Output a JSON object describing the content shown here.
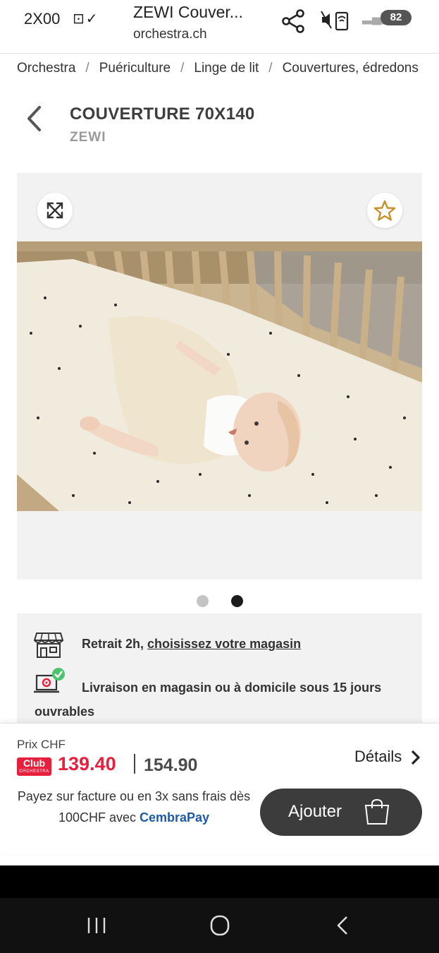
{
  "status_bar": {
    "time": "2X00",
    "left_icons": "⊡✓",
    "battery": "82",
    "signal_icon": "signal-bars-icon"
  },
  "browser": {
    "page_title": "ZEWI Couver...",
    "url": "orchestra.ch"
  },
  "breadcrumb": [
    "Orchestra",
    "Puériculture",
    "Linge de lit",
    "Couvertures, édredons"
  ],
  "breadcrumb_separator": "/",
  "product": {
    "title": "COUVERTURE 70X140",
    "brand": "ZEWI"
  },
  "gallery": {
    "total_images": 2,
    "active_index": 2
  },
  "info": {
    "pickup_prefix": "Retrait 2h, ",
    "pickup_link": "choisissez votre magasin",
    "delivery": "Livraison en magasin ou à domicile sous 15 jours ouvrables"
  },
  "purchase": {
    "price_label": "Prix CHF",
    "club_badge": "Club",
    "club_badge_sub": "ORCHESTRA",
    "club_price": "139.40",
    "regular_price": "154.90",
    "details_label": "Détails",
    "payment_text": "Payez sur facture ou en 3x sans frais dès 100CHF avec ",
    "payment_brand": "CembraPay",
    "add_button": "Ajouter"
  },
  "colors": {
    "accent_red": "#e6203c",
    "button_dark": "#3c3c3c",
    "cembra_blue": "#1f5aa6",
    "panel_gray": "#f2f2f2"
  }
}
